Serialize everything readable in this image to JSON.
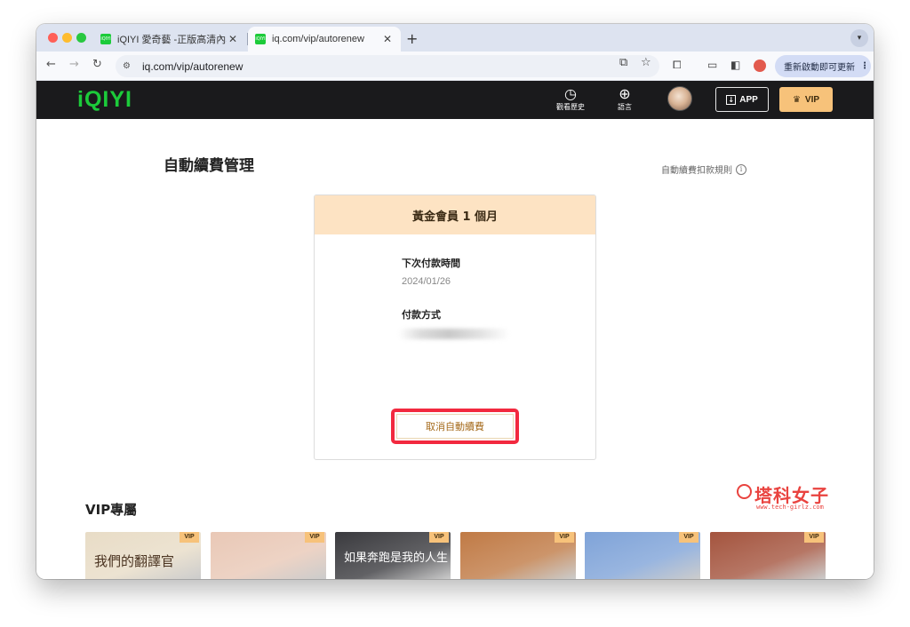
{
  "browser": {
    "tabs": [
      {
        "title": "iQIYI 愛奇藝 -正版高清內容免費",
        "favicon_text": "iQIYI"
      },
      {
        "title": "iq.com/vip/autorenew",
        "favicon_text": "iQIYI"
      }
    ],
    "url": "iq.com/vip/autorenew",
    "update_button": "重新啟動即可更新"
  },
  "site_header": {
    "logo": "iQIYI",
    "history_label": "觀看歷史",
    "language_label": "語言",
    "app_label": "APP",
    "vip_label": "VIP"
  },
  "page": {
    "title": "自動續費管理",
    "rules_link": "自動續費扣款規則"
  },
  "card": {
    "plan_name": "黃金會員 1 個月",
    "next_payment_label": "下次付款時間",
    "next_payment_date": "2024/01/26",
    "payment_method_label": "付款方式",
    "cancel_button": "取消自動續費"
  },
  "watermark": {
    "text": "塔科女子",
    "url": "www.tech-girlz.com"
  },
  "vip_section": {
    "heading": "VIP專屬",
    "badge": "VIP",
    "posters": [
      {
        "title": "我們的翻譯官",
        "color": "#e8dcc6"
      },
      {
        "title": "",
        "color": "#e9c8b6"
      },
      {
        "title": "如果奔跑是我的人生",
        "color": "#3a3a3e"
      },
      {
        "title": "",
        "color": "#c07a45"
      },
      {
        "title": "",
        "color": "#7fa3d8"
      },
      {
        "title": "",
        "color": "#a4543e"
      }
    ]
  },
  "colors": {
    "brand_green": "#1ccb3a",
    "vip_gold": "#f7c27a",
    "highlight_red": "#f2293f"
  }
}
